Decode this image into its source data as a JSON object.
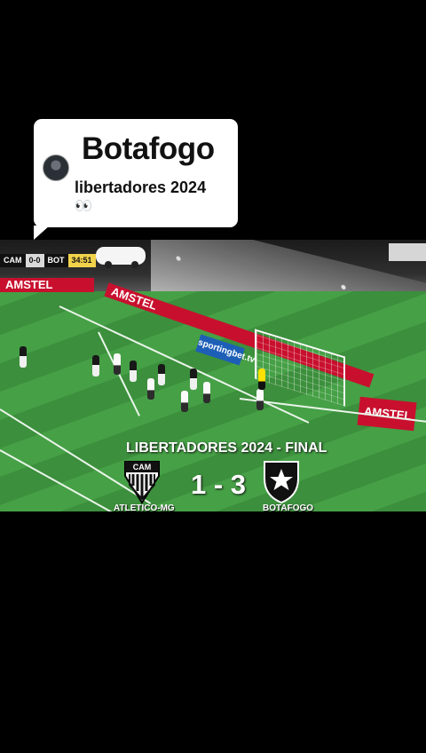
{
  "comment": {
    "title": "Botafogo",
    "text": "libertadores 2024",
    "emoji": "👀"
  },
  "video": {
    "scoreboard": {
      "home": "CAM",
      "score": "0-0",
      "away": "BOT",
      "time": "34:51"
    },
    "ads": {
      "left": "AMSTEL",
      "middle": "AMSTEL",
      "right": "AMSTEL",
      "small": "sportingbet.tv"
    },
    "overlay": {
      "title": "LIBERTADORES 2024 - FINAL",
      "score": "1 - 3",
      "home_team": "ATLETICO-MG",
      "away_team": "BOTAFOGO"
    }
  }
}
